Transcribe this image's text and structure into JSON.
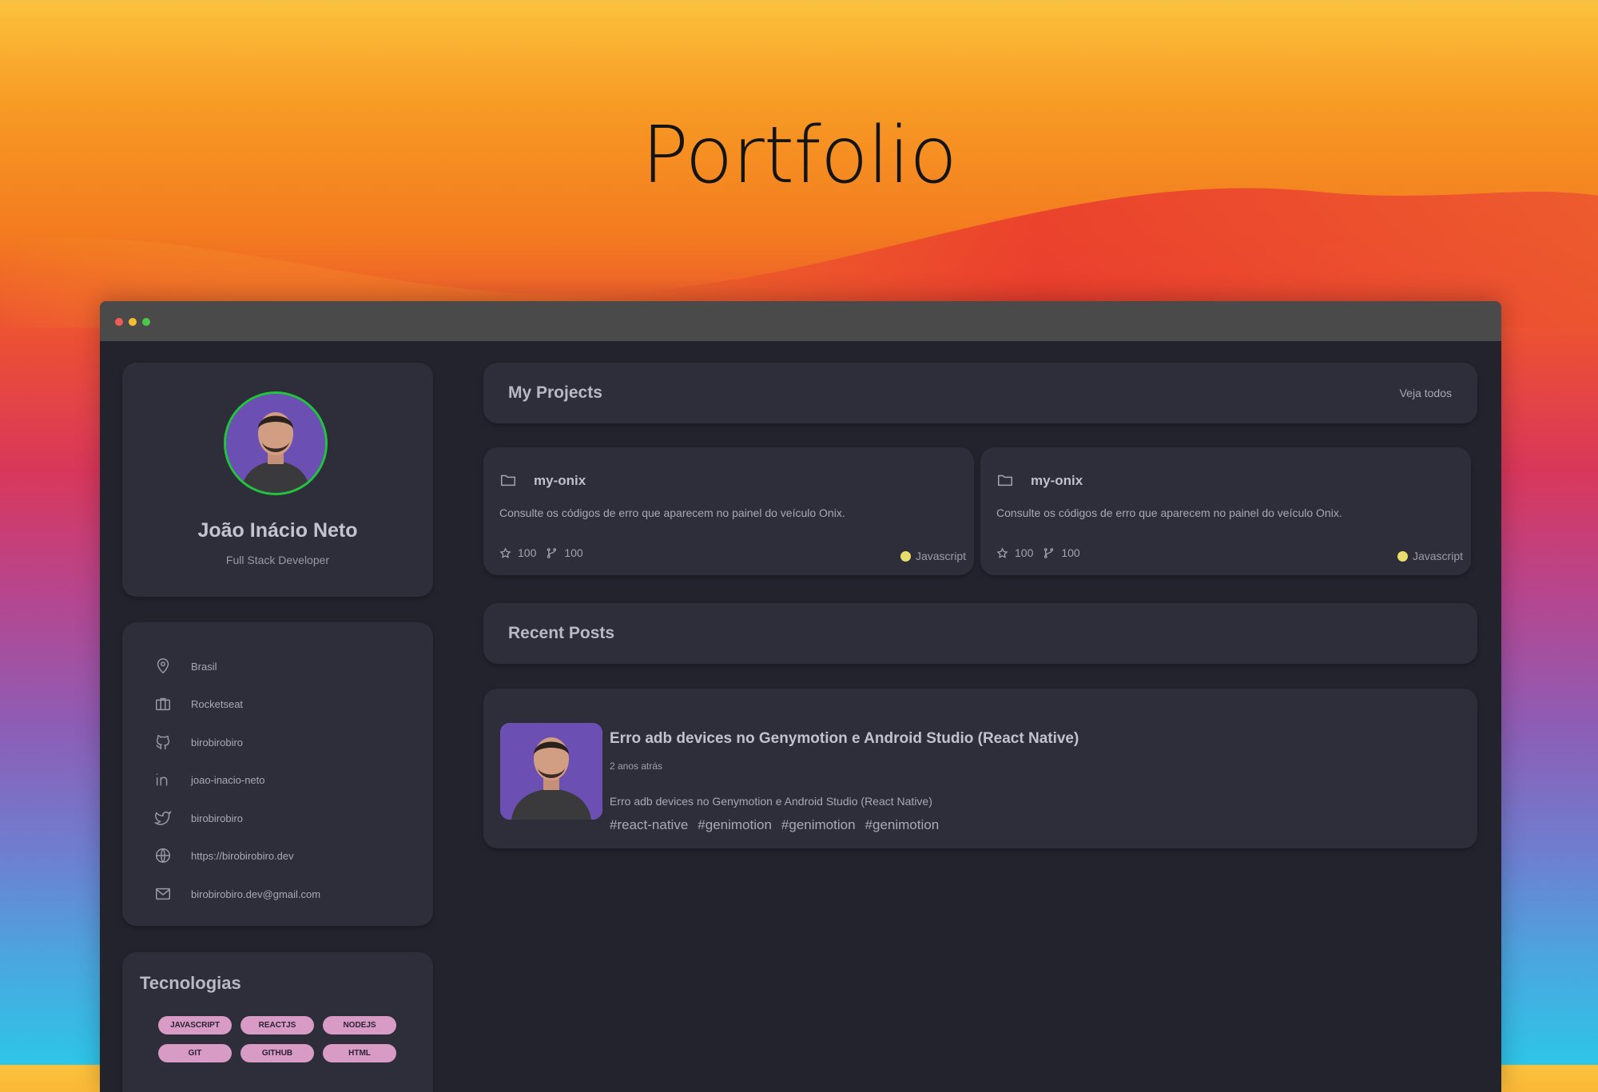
{
  "hero": {
    "title": "Portfolio"
  },
  "profile": {
    "name": "João Inácio Neto",
    "role": "Full Stack Developer"
  },
  "info": [
    {
      "icon": "map-pin-icon",
      "text": "Brasil"
    },
    {
      "icon": "briefcase-icon",
      "text": "Rocketseat"
    },
    {
      "icon": "github-icon",
      "text": "birobirobiro"
    },
    {
      "icon": "linkedin-icon",
      "text": "joao-inacio-neto"
    },
    {
      "icon": "twitter-icon",
      "text": "birobirobiro"
    },
    {
      "icon": "globe-icon",
      "text": "https://birobirobiro.dev"
    },
    {
      "icon": "mail-icon",
      "text": "birobirobiro.dev@gmail.com"
    }
  ],
  "techs": {
    "title": "Tecnologias",
    "tags": [
      "JAVASCRIPT",
      "REACTJS",
      "NODEJS",
      "GIT",
      "GITHUB",
      "HTML"
    ]
  },
  "projects": {
    "title": "My Projects",
    "see_all": "Veja todos",
    "items": [
      {
        "name": "my-onix",
        "description": "Consulte os códigos de erro que aparecem no painel do veículo Onix.",
        "stars": "100",
        "forks": "100",
        "language": "Javascript"
      },
      {
        "name": "my-onix",
        "description": "Consulte os códigos de erro que aparecem no painel do veículo Onix.",
        "stars": "100",
        "forks": "100",
        "language": "Javascript"
      }
    ]
  },
  "recent_posts": {
    "title": "Recent Posts",
    "post": {
      "title": "Erro adb devices no Genymotion e Android Studio (React Native)",
      "date": "2 anos atrás",
      "excerpt": "Erro adb devices no Genymotion e Android Studio (React Native)",
      "tags": [
        "#react-native",
        "#genimotion",
        "#genimotion",
        "#genimotion"
      ]
    }
  },
  "colors": {
    "accent": "#20c53a",
    "tag_bg": "#d79bc5",
    "card_bg": "#2e2e3b",
    "window_bg": "#23232d",
    "language_dot": "#e8dd6b"
  }
}
